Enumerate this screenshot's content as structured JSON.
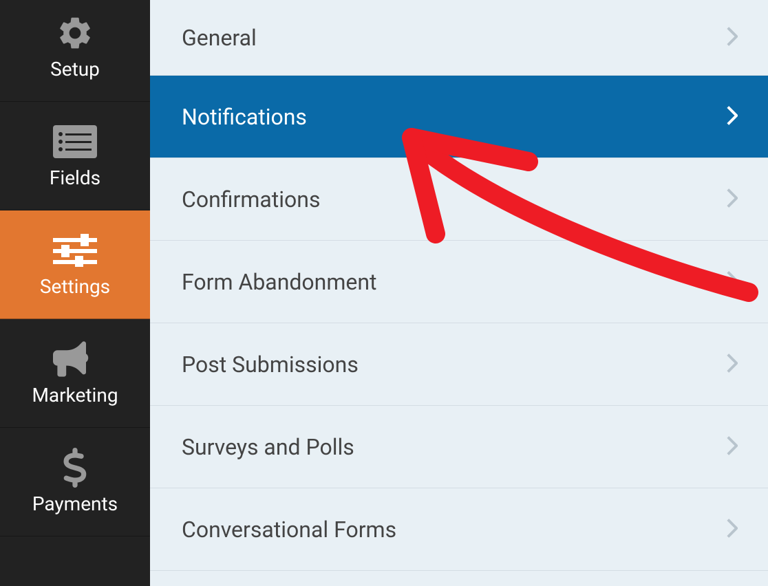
{
  "sidebar": {
    "items": [
      {
        "label": "Setup",
        "icon": "gear-icon",
        "active": false
      },
      {
        "label": "Fields",
        "icon": "list-icon",
        "active": false
      },
      {
        "label": "Settings",
        "icon": "sliders-icon",
        "active": true
      },
      {
        "label": "Marketing",
        "icon": "bullhorn-icon",
        "active": false
      },
      {
        "label": "Payments",
        "icon": "dollar-icon",
        "active": false
      }
    ]
  },
  "settings": {
    "items": [
      {
        "label": "General",
        "selected": false
      },
      {
        "label": "Notifications",
        "selected": true
      },
      {
        "label": "Confirmations",
        "selected": false
      },
      {
        "label": "Form Abandonment",
        "selected": false
      },
      {
        "label": "Post Submissions",
        "selected": false
      },
      {
        "label": "Surveys and Polls",
        "selected": false
      },
      {
        "label": "Conversational Forms",
        "selected": false
      }
    ]
  },
  "colors": {
    "sidebar_bg": "#222222",
    "sidebar_active": "#e27730",
    "row_selected": "#0a6aa8",
    "main_bg": "#e8f0f5",
    "annotation": "#ee1c25"
  }
}
